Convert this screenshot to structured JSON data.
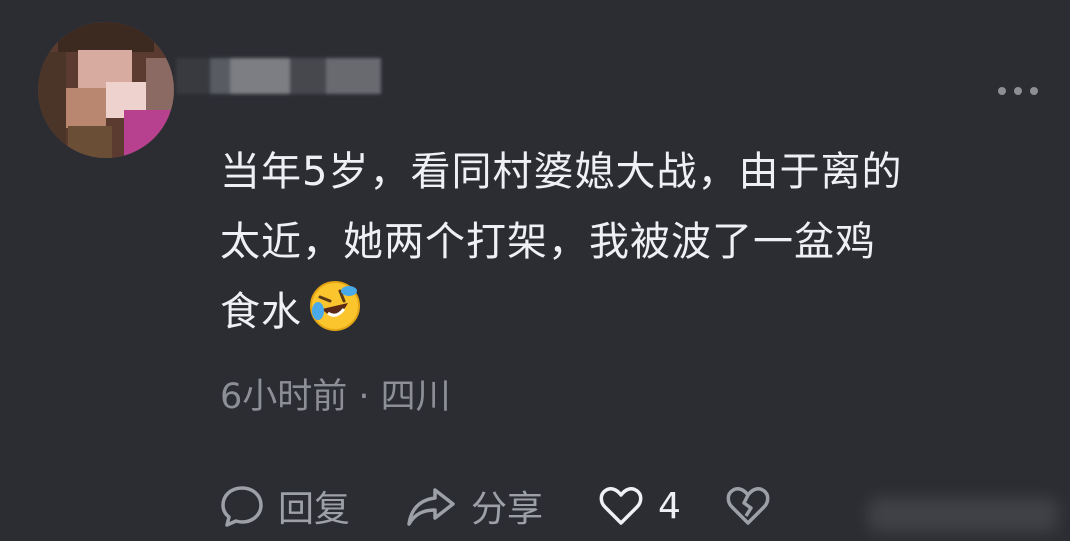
{
  "comment": {
    "lines": [
      "当年5岁，看同村婆媳大战，由于离的",
      "太近，她两个打架，我被波了一盆鸡",
      "食水"
    ],
    "emoji_name": "rolling-on-floor-laughing-emoji"
  },
  "meta": {
    "text": "6小时前 · 四川"
  },
  "actions": {
    "reply_label": "回复",
    "share_label": "分享",
    "like_count": "4"
  },
  "icons": {
    "reply": "chat-bubble-icon",
    "share": "share-arrow-icon",
    "like": "heart-icon",
    "dislike": "broken-heart-icon",
    "more": "more-dots-icon"
  },
  "colors": {
    "background": "#2b2d33",
    "text": "#eef0f3",
    "muted": "#8c8f95"
  }
}
